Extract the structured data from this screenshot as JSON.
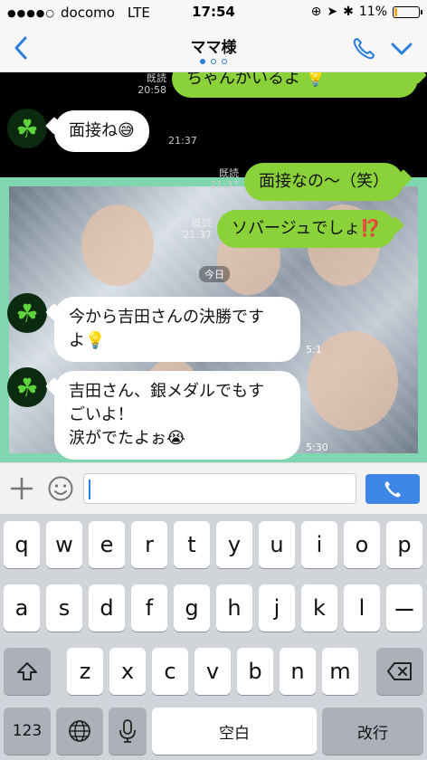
{
  "status": {
    "carrier": "docomo",
    "network": "LTE",
    "time": "17:54",
    "battery": "11%",
    "battery_level": 0.11,
    "battery_color": "#f5a623"
  },
  "nav": {
    "title": "ママ様",
    "back_icon": "chevron-left-icon",
    "call_icon": "phone-icon",
    "menu_icon": "chevron-down-icon",
    "accent": "#2b7de0",
    "page_index": 0,
    "page_count": 3
  },
  "chat": {
    "date_label": "今日",
    "messages": [
      {
        "dir": "out",
        "text": "ちゃんがいるよ",
        "emoji": "💡",
        "read": "既読",
        "time": "20:58"
      },
      {
        "dir": "in",
        "text": "面接ね",
        "emoji": "😅",
        "time": "21:37"
      },
      {
        "dir": "out",
        "text": "面接なの〜（笑）",
        "read": "既読",
        "time": "21:37"
      },
      {
        "dir": "out",
        "text": "ソバージュでしょ",
        "emoji": "⁉️",
        "read": "既読",
        "time": "21:37"
      },
      {
        "dir": "in",
        "text": "今から吉田さんの決勝です",
        "text2": "よ",
        "emoji": "💡",
        "time": "5:1"
      },
      {
        "dir": "in",
        "text": "吉田さん、銀メダルでもす",
        "text2": "ごいよ！",
        "text3": "涙がでたよぉ",
        "emoji": "😭",
        "time": "5:30"
      }
    ],
    "bubble_out_color": "#8ad13a",
    "bubble_in_color": "#ffffff"
  },
  "input": {
    "placeholder": "",
    "value": "",
    "plus_icon": "plus-icon",
    "emoji_icon": "smiley-icon",
    "send_icon": "phone-handset-icon"
  },
  "keyboard": {
    "row1": [
      "q",
      "w",
      "e",
      "r",
      "t",
      "y",
      "u",
      "i",
      "o",
      "p"
    ],
    "row2": [
      "a",
      "s",
      "d",
      "f",
      "g",
      "h",
      "j",
      "k",
      "l",
      "ー"
    ],
    "row3": [
      "z",
      "x",
      "c",
      "v",
      "b",
      "n",
      "m"
    ],
    "numbers_label": "123",
    "space_label": "空白",
    "return_label": "改行",
    "shift_icon": "shift-icon",
    "delete_icon": "backspace-icon",
    "globe_icon": "globe-icon",
    "mic_icon": "microphone-icon"
  }
}
